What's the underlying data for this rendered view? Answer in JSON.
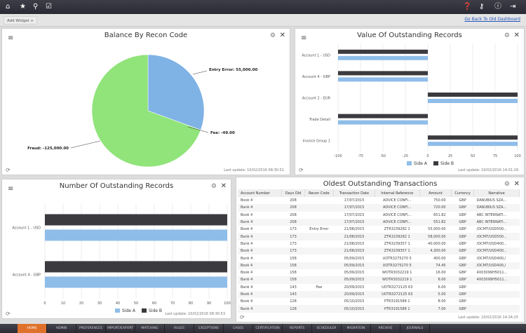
{
  "topbar": {
    "left_icons": [
      "home-icon",
      "star-icon",
      "search-icon",
      "checklist-icon"
    ],
    "right_icons": [
      "help-icon",
      "keys-icon",
      "info-icon",
      "logout-icon"
    ]
  },
  "toolbar": {
    "add_widget": "Add Widget",
    "add_icon": "+",
    "back_link": "Go Back To Old Dashboard"
  },
  "panels": {
    "balance": {
      "title": "Balance By Recon Code",
      "last_update": "Last update: 10/02/2016 08:30:51"
    },
    "value": {
      "title": "Value Of Outstanding Records",
      "last_update": "Last update: 10/02/2016 14:01:29"
    },
    "number": {
      "title": "Number Of Outstanding Records",
      "last_update": "Last update: 10/02/2016 08:30:53"
    },
    "oldest": {
      "title": "Oldest Outstanding Transactions",
      "last_update": "Last update: 10/02/2016 14:24:25",
      "columns": [
        "Account Number",
        "Days Old",
        "Recon Code",
        "Transaction Date",
        "Internal Reference",
        "Amount",
        "Currency",
        "Narrative"
      ],
      "rows": [
        [
          "Book 4",
          "208",
          "",
          "17/07/2015",
          "ADVICE CONFI...",
          "750.00",
          "GBP",
          "DANUBIUS SZA..."
        ],
        [
          "Bank 4",
          "208",
          "",
          "17/07/2015",
          "ADVICE CONFI...",
          "720.00",
          "GBP",
          "DANUBIUS SZA..."
        ],
        [
          "Book 4",
          "208",
          "",
          "17/07/2015",
          "ADVICE CONFI...",
          "651.82",
          "GBP",
          "ABC INTERNATI..."
        ],
        [
          "Bank 4",
          "208",
          "",
          "17/07/2015",
          "ADVICE CONFI...",
          "551.82",
          "GBP",
          "ABC INTERNATI..."
        ],
        [
          "Book 4",
          "173",
          "Entry Error",
          "21/08/2015",
          "ZTR3239282 1",
          "55,000.00",
          "GBP",
          "/OCMT/USD500..."
        ],
        [
          "Bank 4",
          "173",
          "",
          "21/08/2015",
          "ZTR3239282 1",
          "58,000.00",
          "GBP",
          "/OCMT/USD500..."
        ],
        [
          "Bank 4",
          "173",
          "",
          "21/08/2015",
          "ZTR3239357 1",
          "40,000.00",
          "GBP",
          "/OCMT/USD400..."
        ],
        [
          "Book 4",
          "173",
          "",
          "21/08/2015",
          "ZTR3239357 1",
          "4,300.00",
          "GBP",
          "/OCMT/USD400..."
        ],
        [
          "Bank 4",
          "158",
          "",
          "05/09/2015",
          "UOTR3275270 5",
          "400.00",
          "GBP",
          "/OCMT/USD400,/"
        ],
        [
          "Book 4",
          "158",
          "",
          "05/09/2015",
          "UOTR3275270 5",
          "74.45",
          "GBP",
          "/OCMT/USD400,/"
        ],
        [
          "Book 4",
          "158",
          "",
          "05/09/2015",
          "WOTR3032219 1",
          "16.00",
          "GBP",
          "4X03099H5011..."
        ],
        [
          "Bank 4",
          "158",
          "",
          "05/09/2015",
          "WOTR3032219 1",
          "6.00",
          "GBP",
          "4X03099H5011..."
        ],
        [
          "Bank 4",
          "143",
          "Fee",
          "20/09/2015",
          "UOTR3272125 63",
          "6.00",
          "GBP",
          ""
        ],
        [
          "Book 4",
          "143",
          "",
          "20/09/2015",
          "UOTR3272125 63",
          "5.00",
          "GBP",
          ""
        ],
        [
          "Book 4",
          "128",
          "",
          "05/10/2015",
          "PTR3191588 1",
          "8.00",
          "GBP",
          ""
        ],
        [
          "Bank 4",
          "128",
          "",
          "05/10/2015",
          "PTR3191588 1",
          "7.00",
          "GBP",
          ""
        ]
      ]
    }
  },
  "nav": {
    "items": [
      "HOME",
      "ADMIN",
      "PREFERENCES",
      "IMPORT/EXPORT",
      "MATCHING",
      "RULES",
      "EXCEPTIONS",
      "CASES",
      "CERTIFICATION",
      "REPORTS",
      "SCHEDULER",
      "MIGRATION",
      "ARCHIVE",
      "JOURNALS"
    ],
    "active": 0
  },
  "colors": {
    "side_a": "#8fbde9",
    "side_b": "#3a3a3f",
    "pie_blue": "#7fb2e5",
    "pie_green": "#90e47a",
    "active_nav": "#e0712c"
  },
  "chart_data": [
    {
      "type": "pie",
      "title": "Balance By Recon Code",
      "slices": [
        {
          "label": "Entry Error",
          "value": 55000,
          "display": "Entry Error: 55,000.00"
        },
        {
          "label": "Fee",
          "value": -49,
          "display": "Fee: -49.00"
        },
        {
          "label": "Fraud",
          "value": -125000,
          "display": "Fraud: -125,000.00"
        }
      ]
    },
    {
      "type": "bar",
      "orientation": "horizontal",
      "title": "Value Of Outstanding Records",
      "categories": [
        "Account 1 - USD",
        "Account 4 - GBP",
        "Account 2 - EUR",
        "Trade Detail",
        "Invoice Group 1"
      ],
      "series": [
        {
          "name": "Side A",
          "values": [
            -100,
            -100,
            100,
            -100,
            100
          ]
        },
        {
          "name": "Side B",
          "values": [
            -100,
            -100,
            100,
            -100,
            100
          ]
        }
      ],
      "xlim": [
        -100,
        100
      ],
      "ticks": [
        "-100",
        "-75",
        "-50",
        "-25",
        "0",
        "25",
        "50",
        "75",
        "100"
      ],
      "legend": "bottom"
    },
    {
      "type": "bar",
      "orientation": "horizontal",
      "title": "Number Of Outstanding Records",
      "categories": [
        "Account 1 - USD",
        "Account 4 - GBP"
      ],
      "series": [
        {
          "name": "Side A",
          "values": [
            100,
            100
          ]
        },
        {
          "name": "Side B",
          "values": [
            100,
            100
          ]
        }
      ],
      "xlim": [
        0,
        100
      ],
      "ticks": [
        "0",
        "10",
        "20",
        "30",
        "40",
        "50",
        "60",
        "70",
        "80",
        "90",
        "100"
      ],
      "legend": "bottom"
    }
  ]
}
